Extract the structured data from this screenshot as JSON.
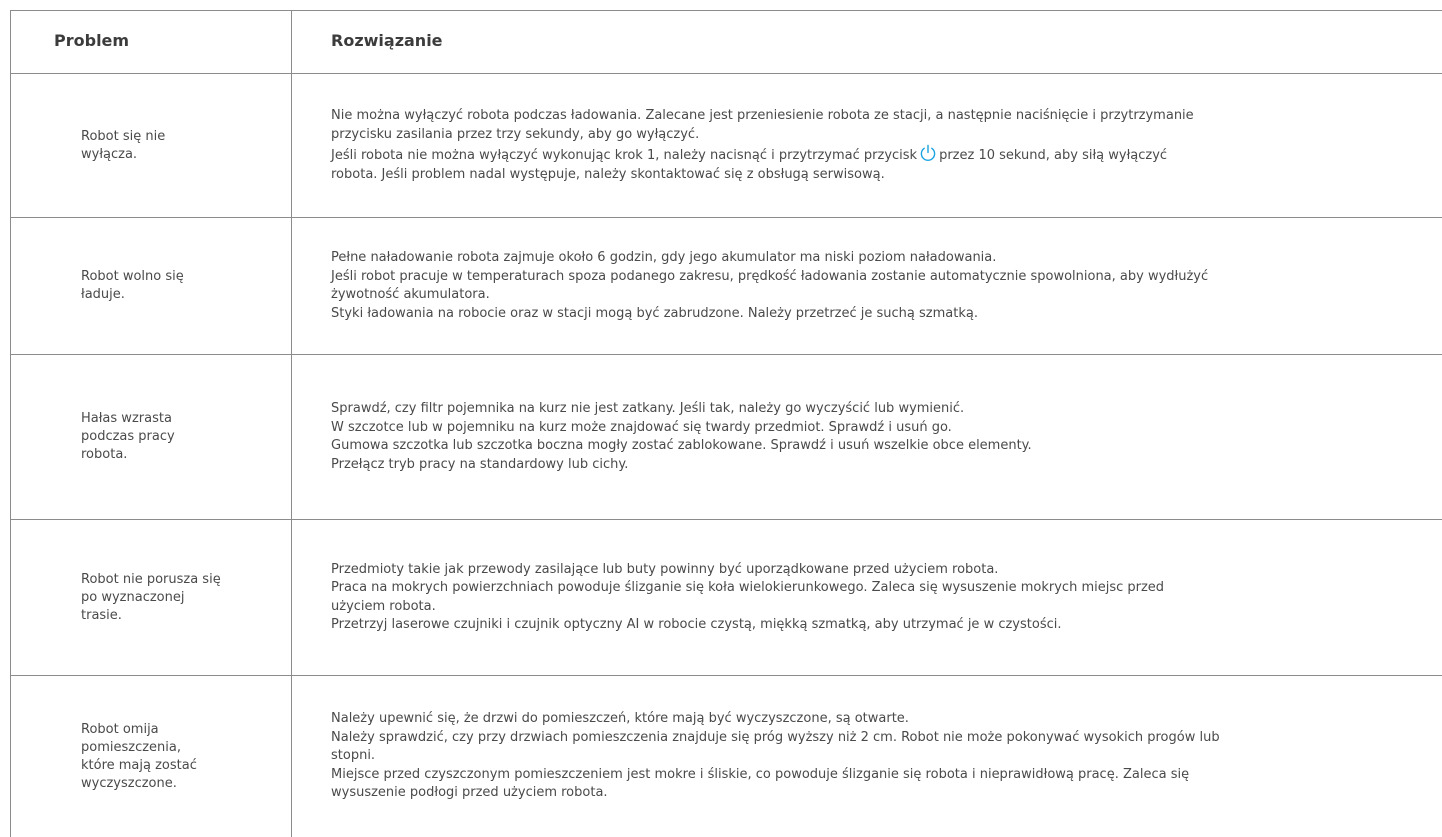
{
  "header": {
    "problem": "Problem",
    "solution": "Rozwiązanie"
  },
  "rows": [
    {
      "problem": [
        "Robot się nie",
        "wyłącza."
      ],
      "solution": [
        "Nie można wyłączyć robota podczas ładowania. Zalecane jest przeniesienie robota ze stacji, a następnie naciśnięcie i przytrzymanie",
        "przycisku zasilania przez trzy sekundy, aby go wyłączyć.",
        {
          "before": "Jeśli robota nie można wyłączyć wykonując krok 1, należy nacisnąć i przytrzymać przycisk",
          "icon": "power-icon",
          "after": "przez 10 sekund, aby siłą wyłączyć"
        },
        "robota. Jeśli problem nadal występuje, należy skontaktować się z obsługą serwisową."
      ]
    },
    {
      "problem": [
        "Robot wolno się",
        "ładuje."
      ],
      "solution": [
        "Pełne naładowanie robota zajmuje około 6 godzin, gdy jego akumulator ma niski poziom naładowania.",
        "Jeśli robot pracuje w temperaturach spoza podanego zakresu, prędkość ładowania zostanie automatycznie spowolniona, aby wydłużyć",
        "żywotność akumulatora.",
        "Styki ładowania na robocie oraz w stacji mogą być zabrudzone. Należy przetrzeć je suchą szmatką."
      ]
    },
    {
      "problem": [
        "Hałas wzrasta",
        "podczas pracy",
        "robota."
      ],
      "solution": [
        "Sprawdź, czy filtr pojemnika na kurz nie jest zatkany. Jeśli tak, należy go wyczyścić lub wymienić.",
        "W szczotce lub w pojemniku na kurz może znajdować się twardy przedmiot. Sprawdź i usuń go.",
        "Gumowa szczotka lub szczotka boczna mogły zostać zablokowane. Sprawdź i usuń wszelkie obce elementy.",
        "Przełącz tryb pracy na standardowy lub cichy."
      ]
    },
    {
      "problem": [
        "Robot nie porusza się",
        "po wyznaczonej",
        "trasie."
      ],
      "solution": [
        "Przedmioty takie jak przewody zasilające lub buty powinny być uporządkowane przed użyciem robota.",
        "Praca na mokrych powierzchniach powoduje ślizganie się koła wielokierunkowego. Zaleca się wysuszenie mokrych miejsc przed",
        "użyciem robota.",
        "Przetrzyj laserowe czujniki i czujnik optyczny AI w robocie czystą, miękką szmatką, aby utrzymać je w czystości."
      ]
    },
    {
      "problem": [
        "Robot omija",
        "pomieszczenia,",
        "które mają zostać",
        "wyczyszczone."
      ],
      "solution": [
        "Należy upewnić się, że drzwi do pomieszczeń, które mają być wyczyszczone, są otwarte.",
        "Należy sprawdzić, czy przy drzwiach pomieszczenia znajduje się próg wyższy niż 2 cm. Robot nie może pokonywać wysokich progów lub",
        "stopni.",
        "Miejsce przed czyszczonym pomieszczeniem jest mokre i śliskie, co powoduje ślizganie się robota i nieprawidłową pracę. Zaleca się",
        "wysuszenie podłogi przed użyciem robota."
      ]
    }
  ],
  "colors": {
    "border": "#8c8c8c",
    "text": "#4a4a4a",
    "icon": "#1aa3e0"
  }
}
